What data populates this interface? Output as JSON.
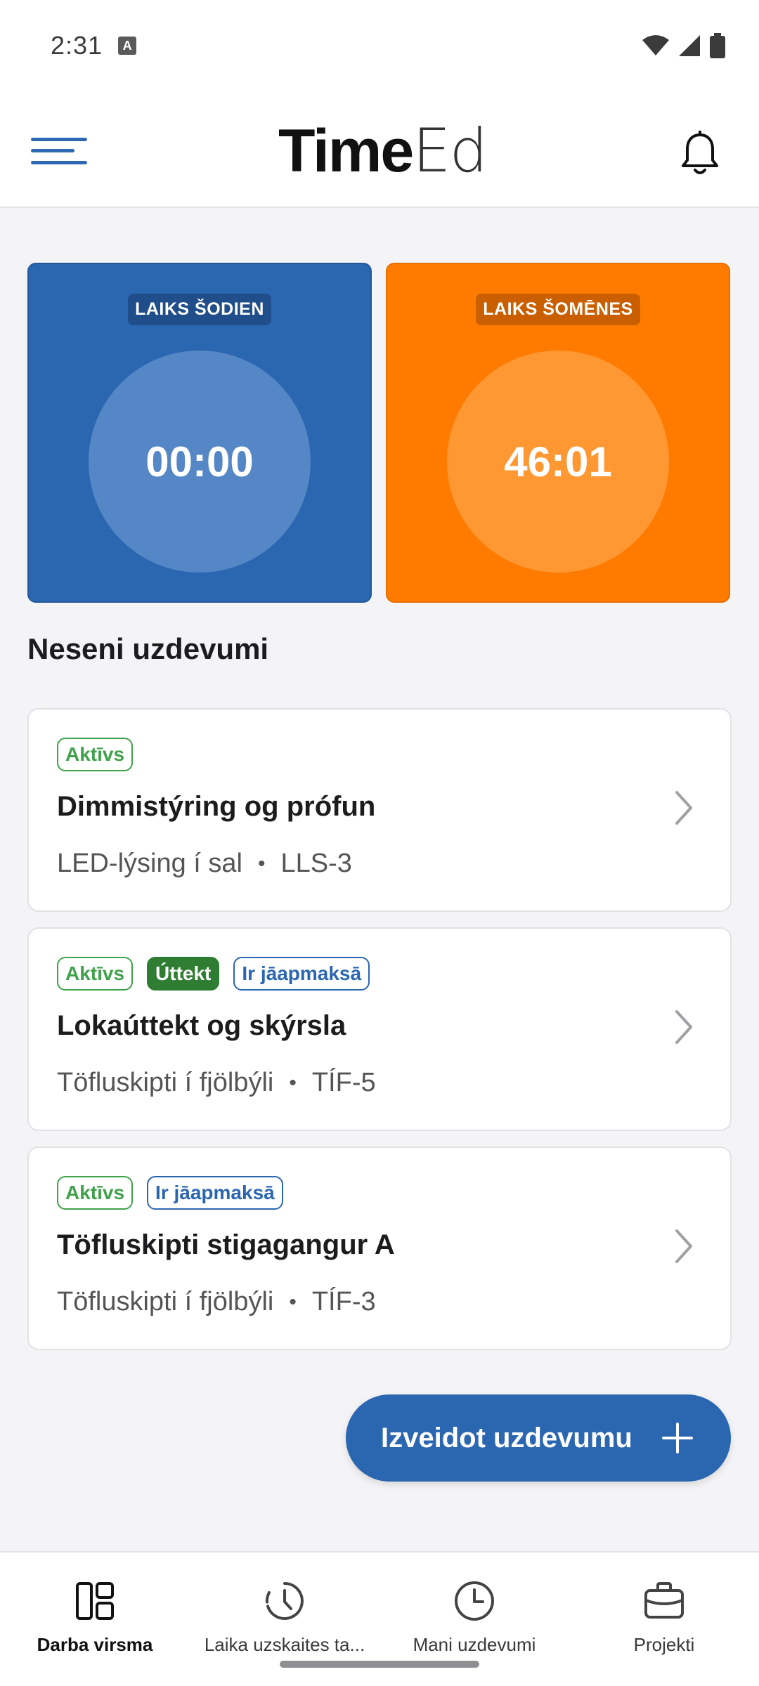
{
  "status_bar": {
    "time": "2:31",
    "notification_icon": "a-icon"
  },
  "header": {
    "logo_bold": "Time",
    "logo_light": "Ed",
    "menu_icon": "hamburger-icon",
    "bell_icon": "bell-icon"
  },
  "stats": {
    "today": {
      "label": "LAIKS ŠODIEN",
      "value": "00:00",
      "color": "#2b66b1"
    },
    "month": {
      "label": "LAIKS ŠOMĒNES",
      "value": "46:01",
      "color": "#ff7b00"
    }
  },
  "recent": {
    "title": "Neseni uzdevumi",
    "tasks": [
      {
        "badges": [
          "Aktīvs"
        ],
        "title": "Dimmistýring og prófun",
        "project": "LED-lýsing í sal",
        "code": "LLS-3"
      },
      {
        "badges": [
          "Aktīvs",
          "Úttekt",
          "Ir jāapmaksā"
        ],
        "title": "Lokaúttekt og skýrsla",
        "project": "Töfluskipti í fjölbýli",
        "code": "TÍF-5"
      },
      {
        "badges": [
          "Aktīvs",
          "Ir jāapmaksā"
        ],
        "title": "Töfluskipti stigagangur A",
        "project": "Töfluskipti í fjölbýli",
        "code": "TÍF-3"
      }
    ]
  },
  "fab": {
    "label": "Izveidot uzdevumu",
    "icon": "plus-icon"
  },
  "bottom_nav": {
    "items": [
      {
        "label": "Darba virsma",
        "icon": "dashboard-icon",
        "selected": true
      },
      {
        "label": "Laika uzskaites ta...",
        "icon": "clock-timer-icon",
        "selected": false
      },
      {
        "label": "Mani uzdevumi",
        "icon": "clock-icon",
        "selected": false
      },
      {
        "label": "Projekti",
        "icon": "briefcase-icon",
        "selected": false
      }
    ]
  },
  "colors": {
    "accent": "#2b66b1",
    "orange": "#ff7b00",
    "active_badge": "#3fa24a",
    "audit_badge": "#2e7d32"
  }
}
